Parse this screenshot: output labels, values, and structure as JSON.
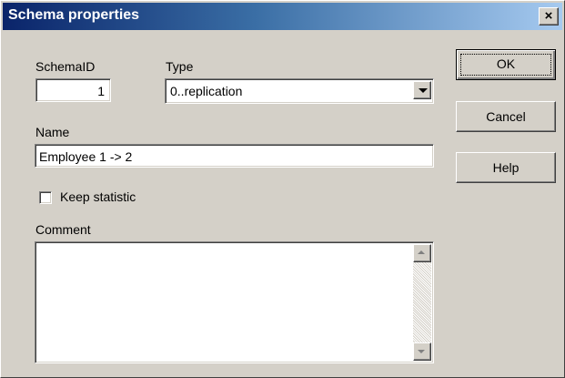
{
  "window": {
    "title": "Schema properties",
    "close_glyph": "×"
  },
  "schema_id": {
    "label": "SchemaID",
    "value": "1"
  },
  "type": {
    "label": "Type",
    "selected": "0..replication"
  },
  "name": {
    "label": "Name",
    "value": "Employee 1 -> 2"
  },
  "keep_statistic": {
    "label": "Keep statistic",
    "checked": false
  },
  "comment": {
    "label": "Comment",
    "value": ""
  },
  "buttons": {
    "ok": "OK",
    "cancel": "Cancel",
    "help": "Help"
  },
  "icons": {
    "close": "close-icon",
    "dropdown": "chevron-down-icon",
    "scroll_up": "scroll-up-icon",
    "scroll_down": "scroll-down-icon"
  },
  "colors": {
    "dialog_bg": "#d4d0c8",
    "title_start": "#0a246a",
    "title_end": "#a6caf0",
    "title_text": "#ffffff"
  }
}
